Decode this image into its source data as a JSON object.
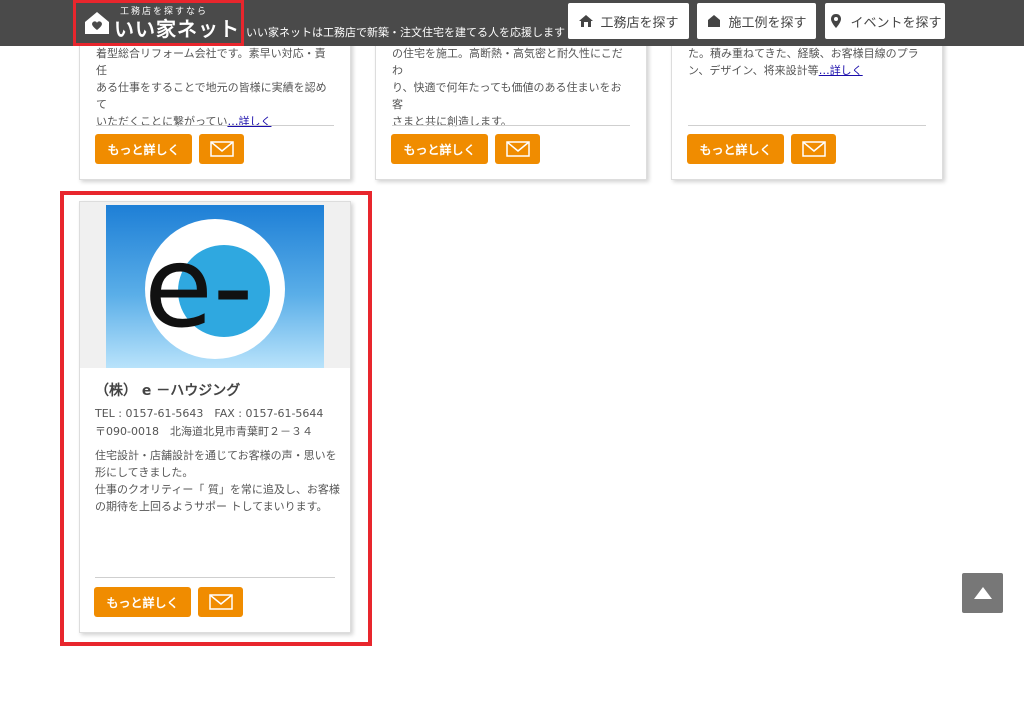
{
  "header": {
    "logo_sub": "工務店を探すなら",
    "logo_main": "いい家ネット",
    "tagline": "いい家ネットは工務店で新築・注文住宅を建てる人を応援します",
    "nav": [
      {
        "label": "工務店を探す",
        "icon": "builder-icon"
      },
      {
        "label": "施工例を探す",
        "icon": "house-icon"
      },
      {
        "label": "イベントを探す",
        "icon": "map-pin-icon"
      }
    ]
  },
  "cards_top": [
    {
      "lines": [
        "着型総合リフォーム会社です。素早い対応・責任",
        "ある仕事をすることで地元の皆様に実績を認めて",
        "いただくことに繋がってい"
      ],
      "more_link": "…詳しく",
      "more_label": "もっと詳しく"
    },
    {
      "lines": [
        "の住宅を施工。高断熱・高気密と耐久性にこだわ",
        "り、快適で何年たっても価値のある住まいをお客",
        "さまと共に創造します。"
      ],
      "more_link": "",
      "more_label": "もっと詳しく"
    },
    {
      "lines": [
        "た。積み重ねてきた、経験、お客様目線のプラ",
        "ン、デザイン、将来設計等"
      ],
      "more_link": "…詳しく",
      "more_label": "もっと詳しく"
    }
  ],
  "featured": {
    "logo_text": "e-",
    "name": "（株） e －ハウジング",
    "tel_fax": "TEL : 0157-61-5643　FAX : 0157-61-5644",
    "address": "〒090-0018　北海道北見市青葉町２－３４",
    "desc_lines": [
      "住宅設計・店舗設計を通じてお客様の声・思いを",
      "形にしてきました。",
      "仕事のクオリティー「 質」を常に追及し、お客様",
      "の期待を上回るようサポー トしてまいります。"
    ],
    "more_label": "もっと詳しく"
  },
  "colors": {
    "accent": "#f08c00",
    "highlight": "#e8262d",
    "header_bg": "#4a4a4a"
  }
}
